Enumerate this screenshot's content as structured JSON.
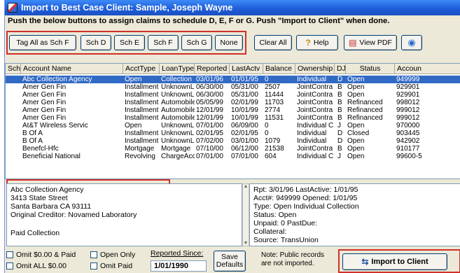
{
  "window": {
    "title": "Import to Best Case Client: Sample, Joseph Wayne",
    "instructions": "Push the below buttons to assign claims to schedule D, E, F or G. Push \"Import to Client\" when done."
  },
  "toolbar": {
    "tag_all": "Tag All as Sch F",
    "sch_d": "Sch D",
    "sch_e": "Sch E",
    "sch_f": "Sch F",
    "sch_g": "Sch G",
    "none": "None",
    "clear_all": "Clear All",
    "help": "Help",
    "view_pdf": "View PDF"
  },
  "table": {
    "columns": [
      "Sch",
      "Account Name",
      "AcctType",
      "LoanType",
      "Reported",
      "LastActv",
      "Balance",
      "Ownership",
      "DJ",
      "Status",
      "Accoun"
    ],
    "rows": [
      [
        "",
        "Abc Collection Agency",
        "Open",
        "Collection",
        "03/01/96",
        "01/01/95",
        "0",
        "Individual",
        "D",
        "Open",
        "949999"
      ],
      [
        "",
        "Amer Gen Fin",
        "Installment",
        "UnknownL",
        "06/30/00",
        "05/31/00",
        "2507",
        "JointContra",
        "B",
        "Open",
        "929901"
      ],
      [
        "",
        "Amer Gen Fin",
        "Installment",
        "UnknownL",
        "06/30/00",
        "05/31/00",
        "11444",
        "JointContra",
        "B",
        "Open",
        "929901"
      ],
      [
        "",
        "Amer Gen Fin",
        "Installment",
        "Automobile",
        "05/05/99",
        "02/01/99",
        "11703",
        "JointContra",
        "B",
        "Refinanced",
        "998012"
      ],
      [
        "",
        "Amer Gen Fin",
        "Installment",
        "Automobile",
        "12/01/99",
        "10/01/99",
        "2774",
        "JointContra",
        "B",
        "Refinanced",
        "999012"
      ],
      [
        "",
        "Amer Gen Fin",
        "Installment",
        "Automobile",
        "12/01/99",
        "10/01/99",
        "11531",
        "JointContra",
        "B",
        "Refinanced",
        "999012"
      ],
      [
        "",
        "At&T Wireless Servic",
        "Open",
        "UnknownL",
        "07/01/00",
        "06/09/00",
        "0",
        "Individual C",
        "J",
        "Open",
        "970000"
      ],
      [
        "",
        "B Of A",
        "Installment",
        "UnknownL",
        "02/01/95",
        "02/01/95",
        "0",
        "Individual",
        "D",
        "Closed",
        "903445"
      ],
      [
        "",
        "B Of A",
        "Installment",
        "UnknownL",
        "07/02/00",
        "03/01/00",
        "1079",
        "Individual",
        "D",
        "Open",
        "942902"
      ],
      [
        "",
        "Benefcl-Hfc",
        "Mortgage",
        "Mortgage",
        "07/10/00",
        "06/12/00",
        "21538",
        "JointContra",
        "B",
        "Open",
        "910177"
      ],
      [
        "",
        "Beneficial National",
        "Revolving",
        "ChargeAcc",
        "07/01/00",
        "07/01/00",
        "604",
        "Individual C",
        "J",
        "Open",
        "99600-5"
      ]
    ]
  },
  "detail_left": {
    "lines": [
      "Abc Collection Agency",
      "3413 State Street",
      "Santa Barbara CA 93111",
      "Original Creditor: Novamed Laboratory",
      "",
      "Paid Collection"
    ]
  },
  "detail_right": {
    "lines": [
      "Rpt: 3/01/96  LastActive: 1/01/95",
      "Acct#: 949999  Opened: 1/01/95",
      "Type: Open Individual Collection",
      "Status: Open",
      "Unpaid: 0  PastDue:",
      "Collateral:",
      "Source: TransUnion"
    ]
  },
  "options": {
    "omit_zero_paid": "Omit $0.00 & Paid",
    "open_only": "Open Only",
    "omit_all_zero": "Omit ALL $0.00",
    "omit_paid": "Omit Paid",
    "reported_since_label": "Reported Since:",
    "reported_since_value": "1/01/1990",
    "save_defaults_1": "Save",
    "save_defaults_2": "Defaults"
  },
  "note": {
    "line1": "Note: Public records",
    "line2": "are not imported."
  },
  "import_button": "Import to Client",
  "colors": {
    "titlebar": "#1c5bd6",
    "selection": "#316ac5",
    "highlight_outline": "#d0302a",
    "window_bg": "#ece9d8"
  }
}
